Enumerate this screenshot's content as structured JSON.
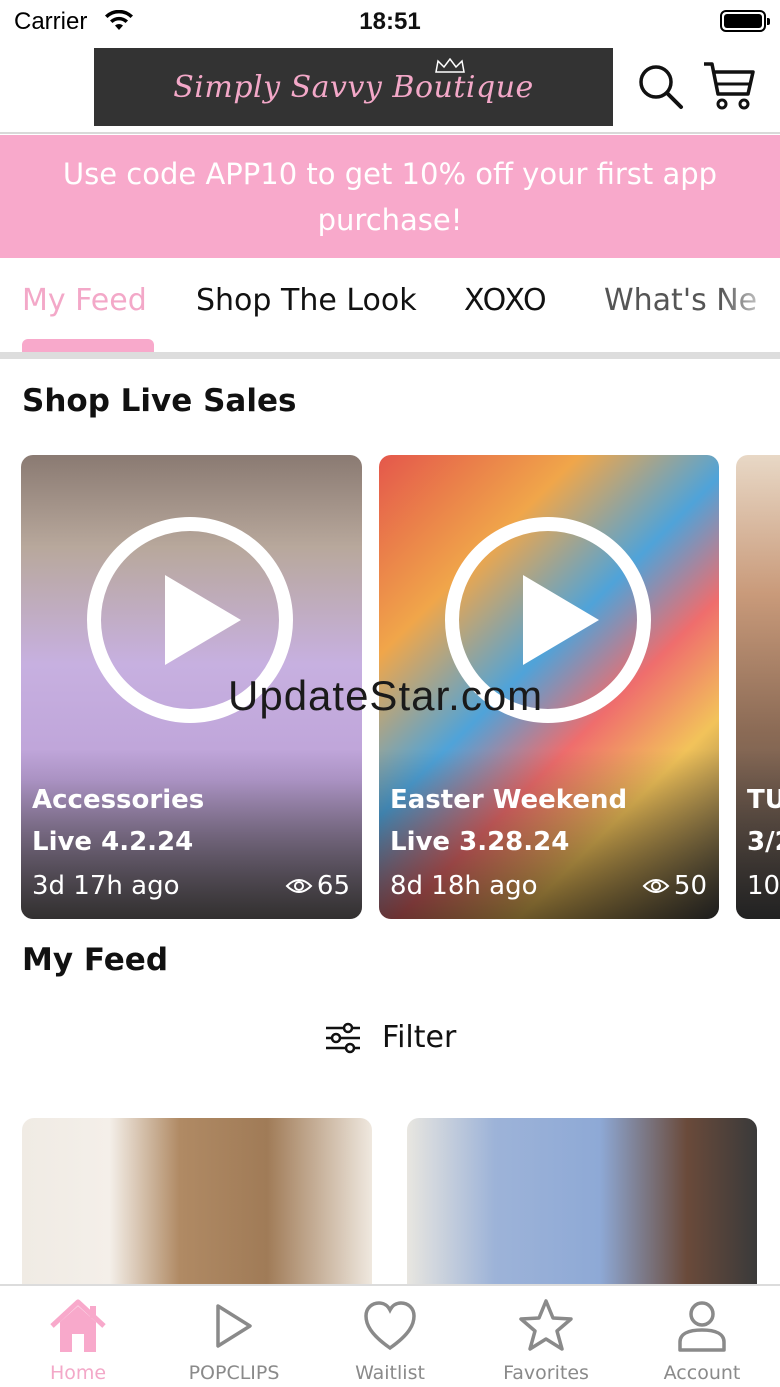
{
  "status_bar": {
    "carrier": "Carrier",
    "time": "18:51"
  },
  "header": {
    "logo_text": "Simply Savvy Boutique"
  },
  "promo": {
    "text": "Use code APP10 to get 10% off your first app purchase!"
  },
  "tabs": [
    {
      "label": "My Feed",
      "active": true
    },
    {
      "label": "Shop The Look"
    },
    {
      "label": "XOXO"
    },
    {
      "label": "What's Ne"
    }
  ],
  "live_sales": {
    "title": "Shop Live Sales",
    "cards": [
      {
        "title": "Accessories",
        "date": "Live 4.2.24",
        "ago": "3d 17h ago",
        "views": "65"
      },
      {
        "title": "Easter Weekend",
        "date": "Live 3.28.24",
        "ago": "8d 18h ago",
        "views": "50"
      },
      {
        "title": "TU",
        "date": "3/2",
        "ago": "10"
      }
    ]
  },
  "watermark": "UpdateStar.com",
  "feed": {
    "title": "My Feed",
    "filter_label": "Filter"
  },
  "bottom_nav": [
    {
      "label": "Home",
      "icon": "home-icon",
      "active": true
    },
    {
      "label": "POPCLIPS",
      "icon": "play-icon"
    },
    {
      "label": "Waitlist",
      "icon": "heart-icon"
    },
    {
      "label": "Favorites",
      "icon": "star-icon"
    },
    {
      "label": "Account",
      "icon": "person-icon"
    }
  ],
  "colors": {
    "accent_pink": "#f8a9cb",
    "logo_bg": "#333333",
    "nav_gray": "#8a8a8a"
  }
}
